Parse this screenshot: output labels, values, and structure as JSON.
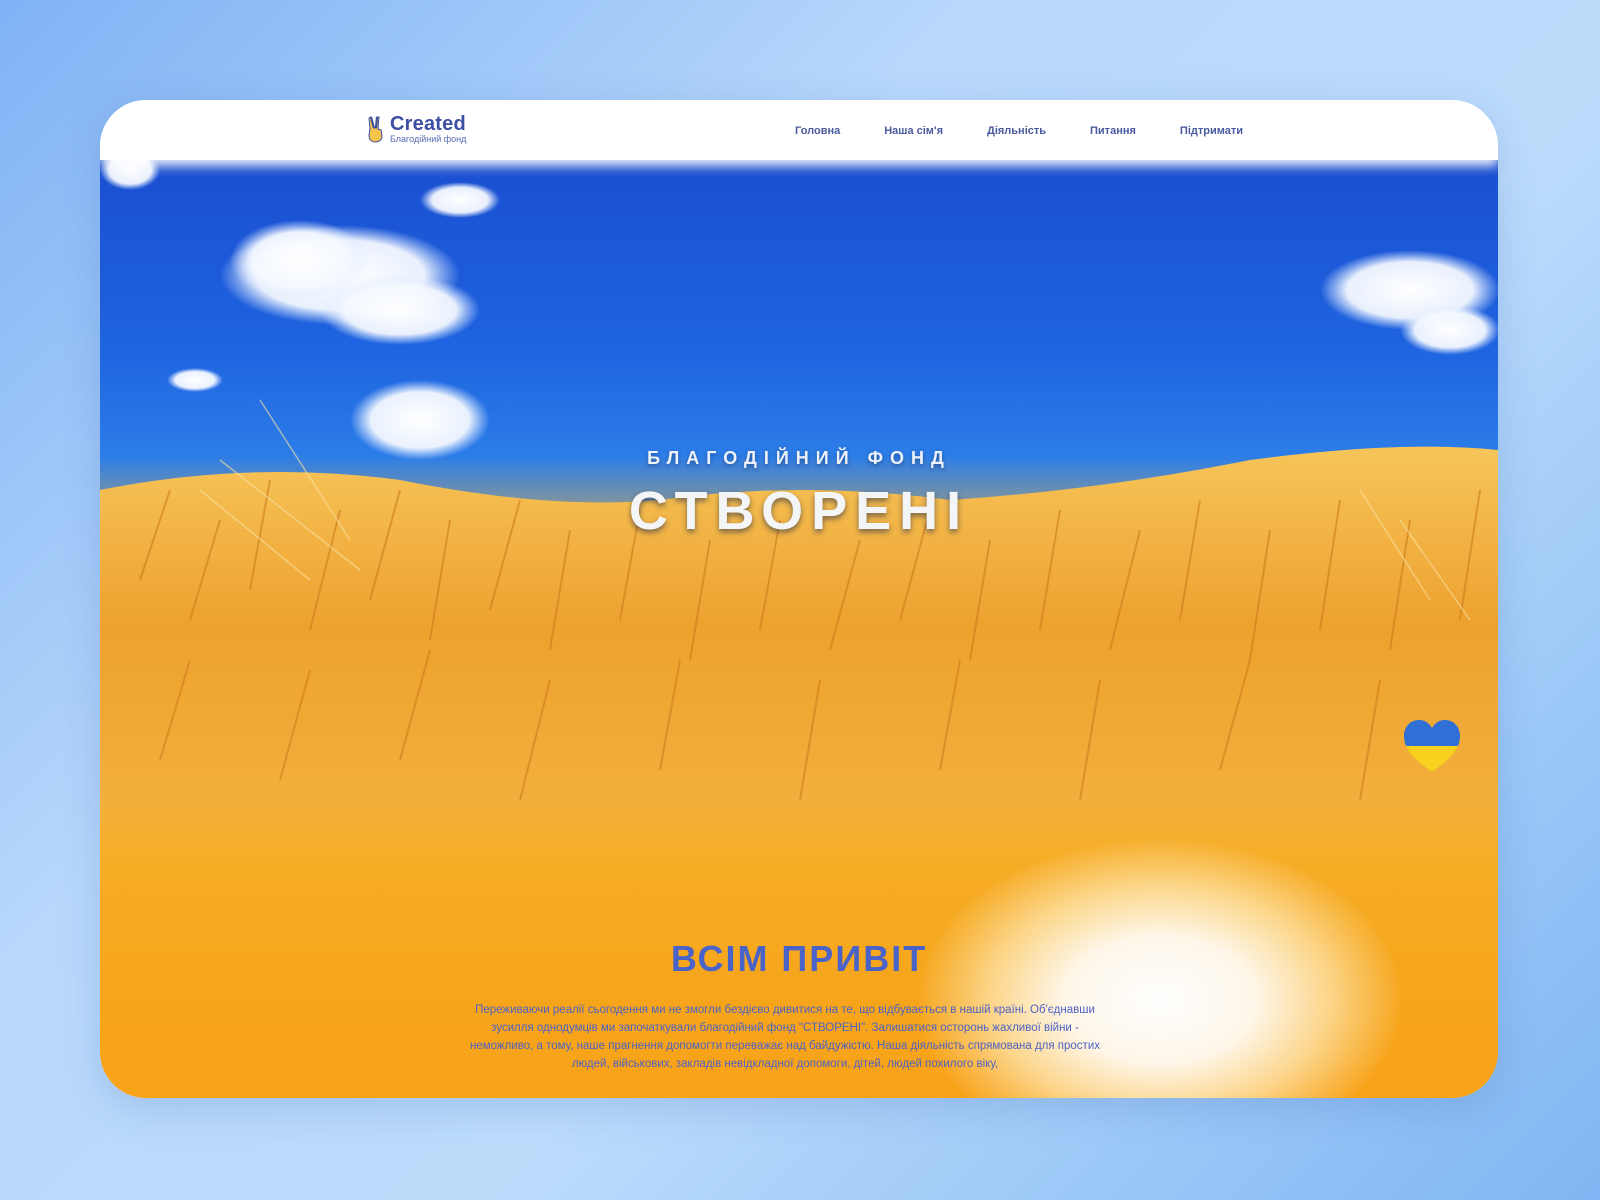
{
  "brand": {
    "name": "Created",
    "tagline": "Благодійний фонд"
  },
  "nav": {
    "items": [
      "Головна",
      "Наша сім'я",
      "Діяльність",
      "Питання",
      "Підтримати"
    ]
  },
  "hero": {
    "kicker": "БЛАГОДІЙНИЙ ФОНД",
    "title": "СТВОРЕНІ"
  },
  "intro": {
    "title": "ВСІМ ПРИВІТ",
    "text": "Переживаючи реалії сьогодення ми не змогли бездієво дивитися на те, що відбувається в нашій країні. Об'єднавши зусилля однодумців ми започаткували благодійний фонд \"СТВОРЕНІ\". Залишатися осторонь жахливої війни - неможливо, а тому, наше прагнення допомогти переважає над байдужістю. Наша діяльність спрямована для простих людей, військових, закладів невідкладної допомоги, дітей, людей похилого віку,"
  },
  "colors": {
    "accent_blue": "#4a63c9",
    "nav_text": "#4a5a9e",
    "sky_blue": "#1e63e0",
    "wheat_gold": "#f6a61c",
    "flag_blue": "#2f6fd6",
    "flag_yellow": "#f7d11e"
  },
  "icons": {
    "logo": "peace-hand-icon",
    "floating": "ukraine-heart-icon"
  }
}
